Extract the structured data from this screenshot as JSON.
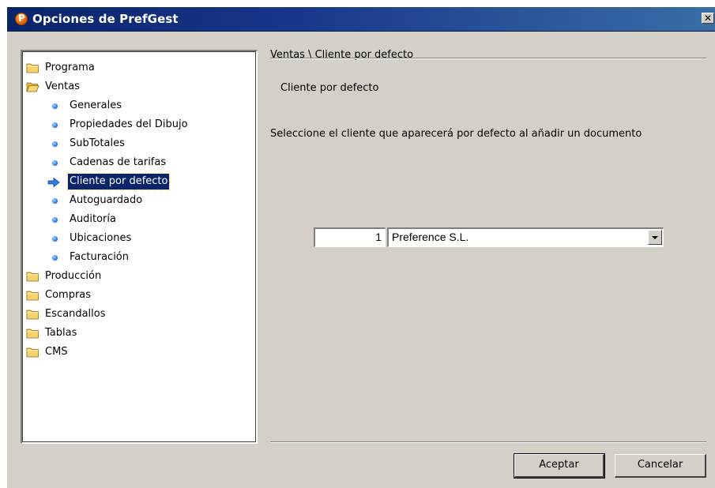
{
  "window": {
    "title": "Opciones de PrefGest",
    "close_label": "✕"
  },
  "tree": {
    "items": [
      {
        "label": "Programa",
        "type": "folder",
        "level": 0
      },
      {
        "label": "Ventas",
        "type": "folder-open",
        "level": 0
      },
      {
        "label": "Generales",
        "type": "leaf",
        "level": 1
      },
      {
        "label": "Propiedades del Dibujo",
        "type": "leaf",
        "level": 1
      },
      {
        "label": "SubTotales",
        "type": "leaf",
        "level": 1
      },
      {
        "label": "Cadenas de tarifas",
        "type": "leaf",
        "level": 1
      },
      {
        "label": "Cliente por defecto",
        "type": "leaf",
        "level": 1,
        "selected": true
      },
      {
        "label": "Autoguardado",
        "type": "leaf",
        "level": 1
      },
      {
        "label": "Auditoría",
        "type": "leaf",
        "level": 1
      },
      {
        "label": "Ubicaciones",
        "type": "leaf",
        "level": 1
      },
      {
        "label": "Facturación",
        "type": "leaf",
        "level": 1
      },
      {
        "label": "Producción",
        "type": "folder",
        "level": 0
      },
      {
        "label": "Compras",
        "type": "folder",
        "level": 0
      },
      {
        "label": "Escandallos",
        "type": "folder",
        "level": 0
      },
      {
        "label": "Tablas",
        "type": "folder",
        "level": 0
      },
      {
        "label": "CMS",
        "type": "folder",
        "level": 0
      }
    ]
  },
  "panel": {
    "breadcrumb": "Ventas \\ Cliente por defecto",
    "heading": "Cliente por defecto",
    "description": "Seleccione el cliente que aparecerá por defecto al añadir un documento",
    "client_code": "1",
    "client_name": "Preference S.L."
  },
  "buttons": {
    "accept": "Aceptar",
    "cancel": "Cancelar"
  },
  "colors": {
    "titlebar": "#0a246a",
    "dialog_bg": "#d4d0c8",
    "selection": "#0a246a",
    "bullet": "#1e6fd8",
    "folder": "#f5d36b"
  }
}
